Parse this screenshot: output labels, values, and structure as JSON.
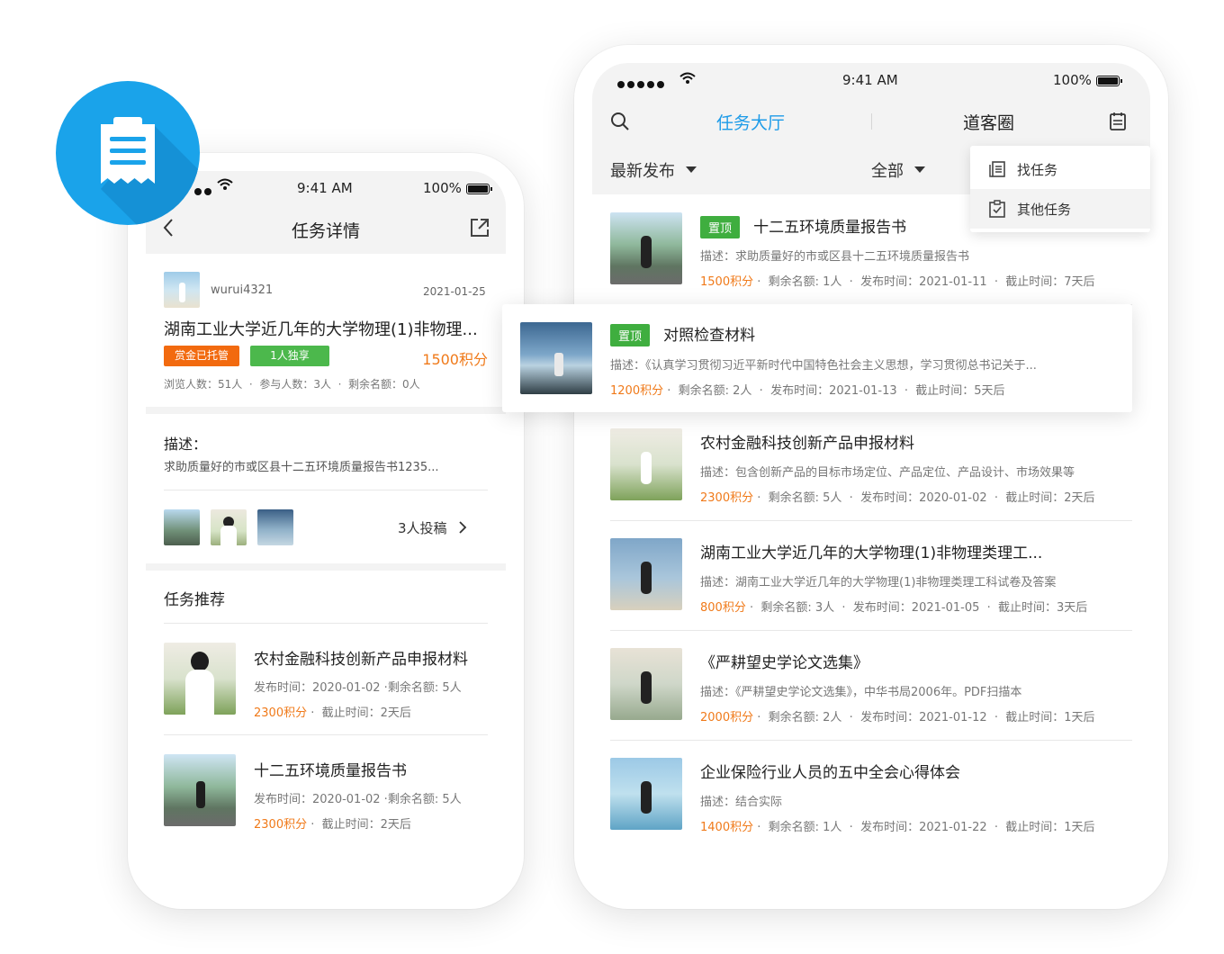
{
  "status": {
    "time": "9:41 AM",
    "battery": "100%"
  },
  "detail": {
    "header_title": "任务详情",
    "author": "wurui4321",
    "date": "2021-01-25",
    "title": "湖南工业大学近几年的大学物理(1)非物理...",
    "badge_hosted": "赏金已托管",
    "badge_exclusive": "1人独享",
    "points": "1500积分",
    "stats": "浏览人数：51人  ·  参与人数：3人  ·  剩余名额：0人",
    "desc_label": "描述：",
    "desc_text": "求助质量好的市或区县十二五环境质量报告书1235...",
    "submissions": "3人投稿",
    "recommend_title": "任务推荐",
    "recommend": [
      {
        "title": "农村金融科技创新产品申报材料",
        "meta": "发布时间：2020-01-02 ·剩余名额: 5人",
        "points": "2300积分",
        "deadline": "·  截止时间：2天后"
      },
      {
        "title": "十二五环境质量报告书",
        "meta": "发布时间：2020-01-02 ·剩余名额: 5人",
        "points": "2300积分",
        "deadline": "·  截止时间：2天后"
      }
    ]
  },
  "hall": {
    "tab_active": "任务大厅",
    "tab_other": "道客圈",
    "filter_sort": "最新发布",
    "filter_all": "全部",
    "menu": [
      {
        "label": "找任务",
        "icon": "list-icon"
      },
      {
        "label": "其他任务",
        "icon": "checklist-icon"
      }
    ],
    "tasks": [
      {
        "pinned": "置顶",
        "title": "十二五环境质量报告书",
        "desc": "描述：求助质量好的市或区县十二五环境质量报告书",
        "points": "1500积分",
        "meta": "·  剩余名额: 1人  ·  发布时间：2021-01-11  ·  截止时间：7天后"
      },
      {
        "pinned": "置顶",
        "title": "对照检查材料",
        "desc": "描述：《认真学习贯彻习近平新时代中国特色社会主义思想，学习贯彻总书记关于...",
        "points": "1200积分",
        "meta": "·  剩余名额: 2人  ·  发布时间：2021-01-13  ·  截止时间：5天后"
      },
      {
        "pinned": "",
        "title": "农村金融科技创新产品申报材料",
        "desc": "描述：包含创新产品的目标市场定位、产品定位、产品设计、市场效果等",
        "points": "2300积分",
        "meta": "·  剩余名额: 5人  ·  发布时间：2020-01-02  ·  截止时间：2天后"
      },
      {
        "pinned": "",
        "title": "湖南工业大学近几年的大学物理(1)非物理类理工...",
        "desc": "描述：湖南工业大学近几年的大学物理(1)非物理类理工科试卷及答案",
        "points": "800积分",
        "meta": "·  剩余名额: 3人  ·  发布时间：2021-01-05  ·  截止时间：3天后"
      },
      {
        "pinned": "",
        "title": "《严耕望史学论文选集》",
        "desc": "描述：《严耕望史学论文选集》，中华书局2006年。PDF扫描本",
        "points": "2000积分",
        "meta": "·  剩余名额: 2人  ·  发布时间：2021-01-12  ·  截止时间：1天后"
      },
      {
        "pinned": "",
        "title": "企业保险行业人员的五中全会心得体会",
        "desc": "描述：结合实际",
        "points": "1400积分",
        "meta": "·  剩余名额: 1人  ·  发布时间：2021-01-22  ·  截止时间：1天后"
      }
    ]
  },
  "colors": {
    "accent": "#1d9be8",
    "orange": "#f07a1a",
    "green": "#3fae3f",
    "badge_orange": "#f26a0f",
    "badge_green": "#4cb84c"
  }
}
